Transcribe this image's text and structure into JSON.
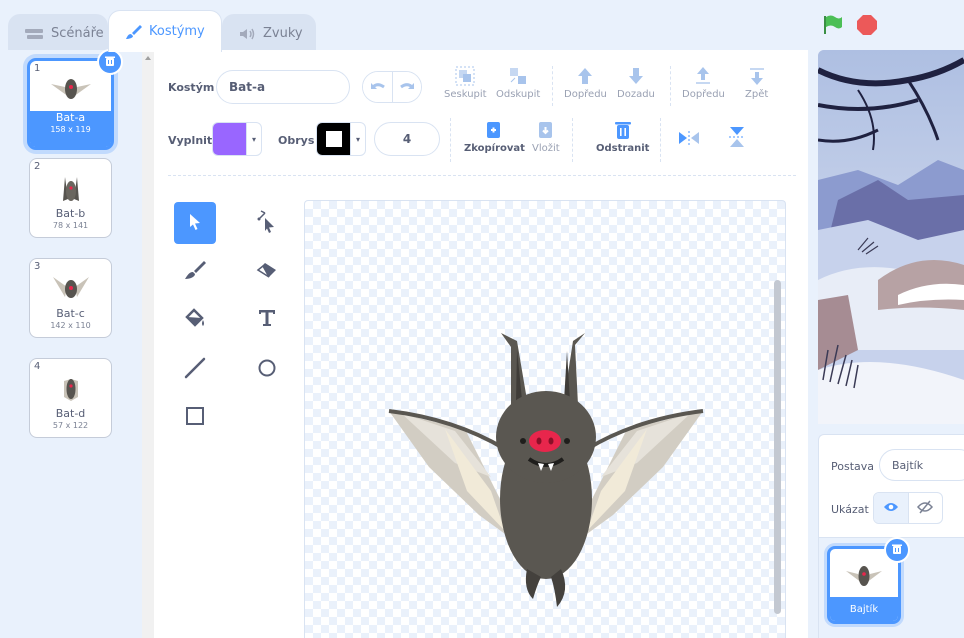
{
  "tabs": [
    {
      "label": "Scénáře",
      "icon": "code-icon"
    },
    {
      "label": "Kostýmy",
      "icon": "brush-icon"
    },
    {
      "label": "Zvuky",
      "icon": "speaker-icon"
    }
  ],
  "costumes": [
    {
      "num": "1",
      "name": "Bat-a",
      "size": "158 x 119",
      "selected": true
    },
    {
      "num": "2",
      "name": "Bat-b",
      "size": "78 x 141",
      "selected": false
    },
    {
      "num": "3",
      "name": "Bat-c",
      "size": "142 x 110",
      "selected": false
    },
    {
      "num": "4",
      "name": "Bat-d",
      "size": "57 x 122",
      "selected": false
    }
  ],
  "editor": {
    "costume_label": "Kostým",
    "costume_name": "Bat-a",
    "group_label": "Seskupit",
    "ungroup_label": "Odskupit",
    "forward_label": "Dopředu",
    "backward_label": "Dozadu",
    "front_label": "Dopředu",
    "back_label": "Zpět",
    "fill_label": "Vyplnit",
    "fill_color": "#9966ff",
    "outline_label": "Obrys",
    "outline_color": "#000000",
    "outline_width": "4",
    "copy_label": "Zkopírovat",
    "paste_label": "Vložit",
    "delete_label": "Odstranit"
  },
  "sprite_info": {
    "sprite_label": "Postava",
    "sprite_name": "Bajtík",
    "show_label": "Ukázat"
  },
  "sprite_tile": {
    "name": "Bajtík"
  },
  "colors": {
    "accent": "#4c97ff",
    "flag": "#4cbf56",
    "stop": "#ec5959"
  }
}
